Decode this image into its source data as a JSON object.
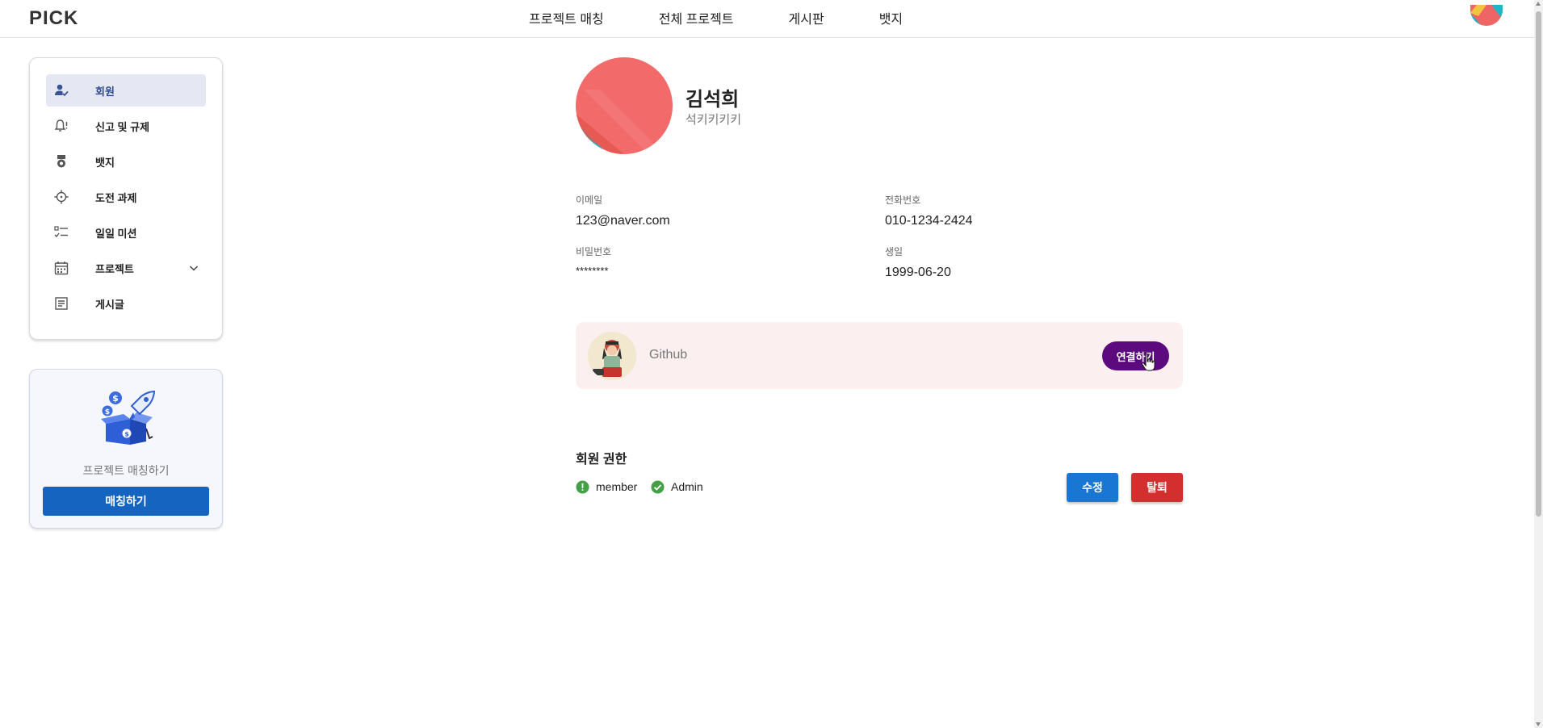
{
  "header": {
    "logo": "PICK",
    "nav": [
      "프로젝트 매칭",
      "전체 프로젝트",
      "게시판",
      "뱃지"
    ]
  },
  "sidebar": {
    "items": [
      {
        "label": "회원",
        "icon": "member-check-icon",
        "active": true
      },
      {
        "label": "신고 및 규제",
        "icon": "bell-alert-icon",
        "active": false
      },
      {
        "label": "뱃지",
        "icon": "medal-icon",
        "active": false
      },
      {
        "label": "도전 과제",
        "icon": "crosshair-icon",
        "active": false
      },
      {
        "label": "일일 미션",
        "icon": "checklist-icon",
        "active": false
      },
      {
        "label": "프로젝트",
        "icon": "calendar-icon",
        "active": false,
        "expandable": true
      },
      {
        "label": "게시글",
        "icon": "article-icon",
        "active": false
      }
    ],
    "active_color": "#e5e8f3"
  },
  "promo": {
    "text": "프로젝트 매칭하기",
    "button": "매칭하기"
  },
  "profile": {
    "name": "김석희",
    "nickname": "석키키키키",
    "fields": {
      "email_label": "이메일",
      "email": "123@naver.com",
      "phone_label": "전화번호",
      "phone": "010-1234-2424",
      "password_label": "비밀번호",
      "password": "********",
      "birth_label": "생일",
      "birth": "1999-06-20"
    }
  },
  "github": {
    "label": "Github",
    "button": "연결하기"
  },
  "permissions": {
    "title": "회원 권한",
    "roles": [
      {
        "label": "member",
        "icon": "alert-circle-icon",
        "color": "#43a047"
      },
      {
        "label": "Admin",
        "icon": "check-circle-icon",
        "color": "#43a047"
      }
    ]
  },
  "actions": {
    "edit": "수정",
    "leave": "탈퇴"
  },
  "colors": {
    "primary": "#1976d2",
    "danger": "#d32f2f",
    "github_button": "#5c0a7e",
    "github_bg": "#fbeff0"
  }
}
